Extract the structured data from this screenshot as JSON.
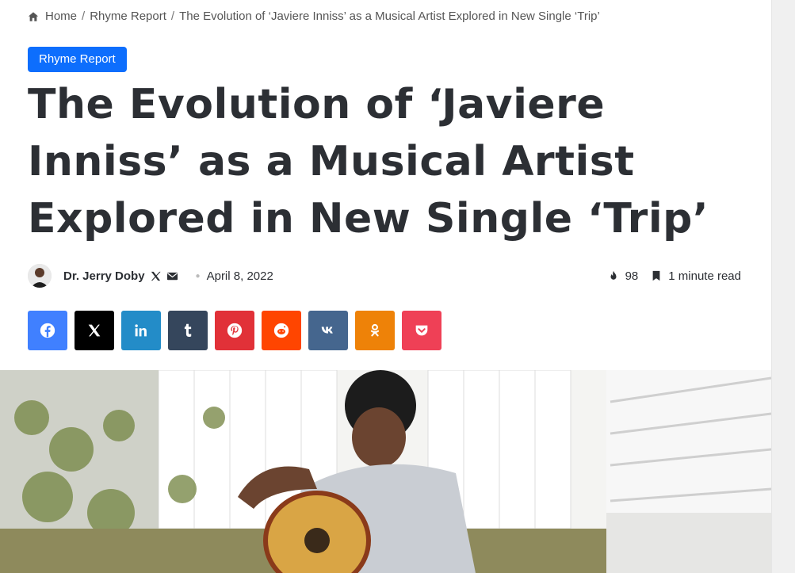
{
  "breadcrumb": {
    "home": "Home",
    "category": "Rhyme Report",
    "current": "The Evolution of ‘Javiere Inniss’ as a Musical Artist Explored in New Single ‘Trip’",
    "separator": "/"
  },
  "post": {
    "category": "Rhyme Report",
    "title": "The Evolution of ‘Javiere Inniss’ as a Musical Artist Explored in New Single ‘Trip’",
    "author": "Dr. Jerry Doby",
    "date": "April 8, 2022",
    "views": "98",
    "read_time": "1 minute read"
  },
  "share": [
    {
      "name": "facebook",
      "color": "#4080ff",
      "icon": "facebook-icon"
    },
    {
      "name": "x",
      "color": "#000000",
      "icon": "x-icon"
    },
    {
      "name": "linkedin",
      "color": "#238cc8",
      "icon": "linkedin-icon"
    },
    {
      "name": "tumblr",
      "color": "#35465c",
      "icon": "tumblr-icon"
    },
    {
      "name": "pinterest",
      "color": "#e13138",
      "icon": "pinterest-icon"
    },
    {
      "name": "reddit",
      "color": "#ff4500",
      "icon": "reddit-icon"
    },
    {
      "name": "vk",
      "color": "#45668e",
      "icon": "vk-icon"
    },
    {
      "name": "odnoklassniki",
      "color": "#ee8208",
      "icon": "odnoklassniki-icon"
    },
    {
      "name": "pocket",
      "color": "#ef4056",
      "icon": "pocket-icon"
    }
  ],
  "colors": {
    "accent": "#0d6efd",
    "text": "#2c2f34"
  }
}
